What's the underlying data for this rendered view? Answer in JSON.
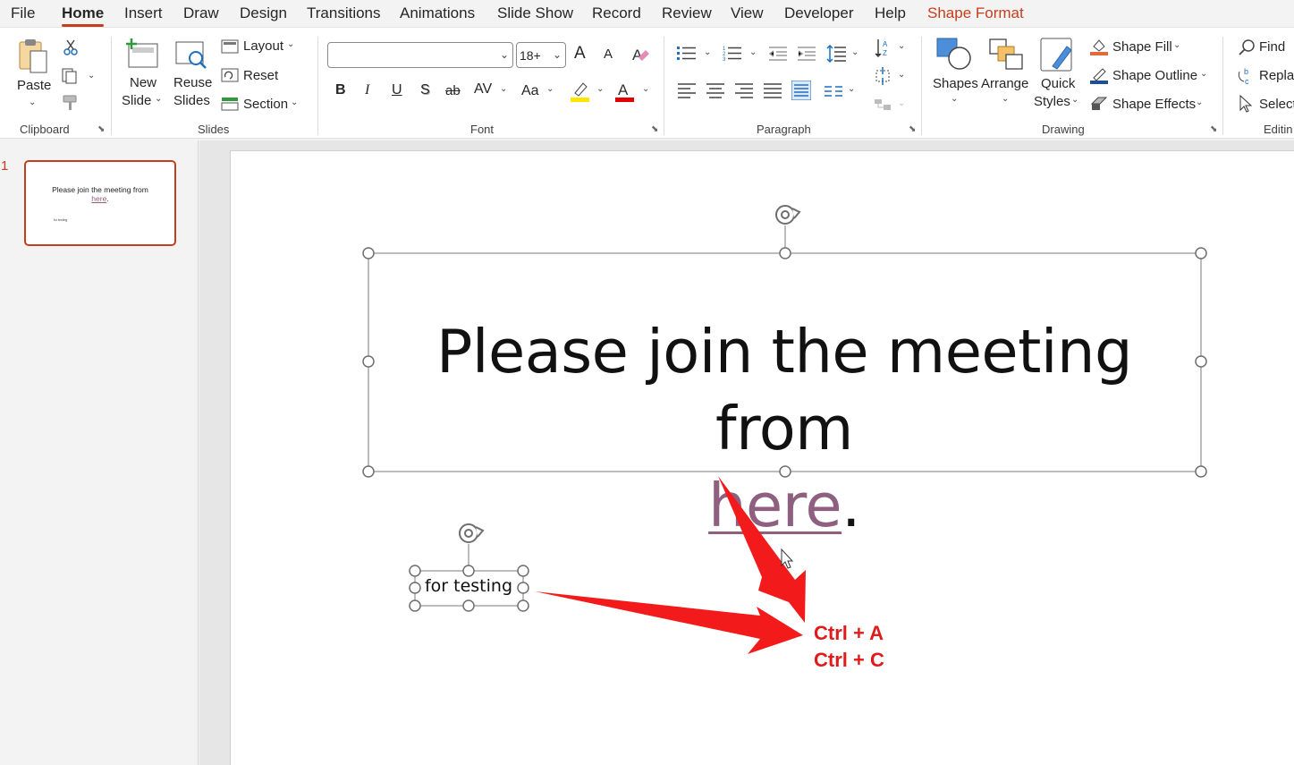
{
  "tabs": [
    "File",
    "Home",
    "Insert",
    "Draw",
    "Design",
    "Transitions",
    "Animations",
    "Slide Show",
    "Record",
    "Review",
    "View",
    "Developer",
    "Help",
    "Shape Format"
  ],
  "ribbon": {
    "clipboard": {
      "paste": "Paste",
      "group": "Clipboard"
    },
    "slides": {
      "new_slide_1": "New",
      "new_slide_2": "Slide",
      "reuse_1": "Reuse",
      "reuse_2": "Slides",
      "layout": "Layout",
      "reset": "Reset",
      "section": "Section",
      "group": "Slides"
    },
    "font": {
      "font_name": "",
      "font_size": "18+",
      "bold": "B",
      "italic": "I",
      "underline": "U",
      "shadow": "S",
      "strike": "ab",
      "spacing": "AV",
      "change_case": "Aa",
      "grow": "A",
      "shrink": "A",
      "group": "Font"
    },
    "paragraph": {
      "group": "Paragraph"
    },
    "drawing": {
      "shapes": "Shapes",
      "arrange": "Arrange",
      "quick_1": "Quick",
      "quick_2": "Styles",
      "fill": "Shape Fill",
      "outline": "Shape Outline",
      "effects": "Shape Effects",
      "group": "Drawing"
    },
    "editing": {
      "find": "Find",
      "replace": "Replac",
      "select": "Select",
      "group": "Editin"
    }
  },
  "colors": {
    "accent": "#c43e1c",
    "link": "#8e5f7e",
    "annotation": "#e11a1a",
    "highlight": "#ffe600",
    "font_color": "#e00000"
  },
  "thumbnail": {
    "number": "1",
    "title_prefix": "Please join the meeting from",
    "title_link": "here",
    "title_suffix": ".",
    "small_text": "for testing"
  },
  "slide": {
    "title_prefix": "Please join the meeting from ",
    "title_link": "here",
    "title_suffix": ".",
    "small_text": "for testing"
  },
  "annotation": {
    "line1": "Ctrl + A",
    "line2": "Ctrl + C"
  }
}
